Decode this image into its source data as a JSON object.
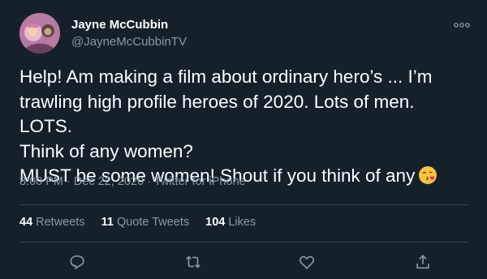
{
  "tweet": {
    "author": {
      "name": "Jayne McCubbin",
      "handle": "@JayneMcCubbinTV",
      "avatar_icon": "user-avatar"
    },
    "text": "Help! Am making a film about ordinary hero’s ... I’m\ntrawling high profile heroes of 2020. Lots of men. LOTS.\nThink of any women?\nMUST be some women! Shout if you think of any",
    "emoji_icon": "face-blowing-a-kiss-emoji",
    "meta": "8:00 PM · Dec 22, 2020 · Twitter for iPhone",
    "stats": {
      "retweets_count": "44",
      "retweets_label": "Retweets",
      "quotes_count": "11",
      "quotes_label": "Quote Tweets",
      "likes_count": "104",
      "likes_label": "Likes"
    },
    "actions": [
      "reply-icon",
      "retweet-icon",
      "like-icon",
      "share-icon"
    ]
  },
  "colors": {
    "background": "#15202b",
    "text_primary": "#ffffff",
    "text_secondary": "#8899a6",
    "divider": "#38444d"
  }
}
